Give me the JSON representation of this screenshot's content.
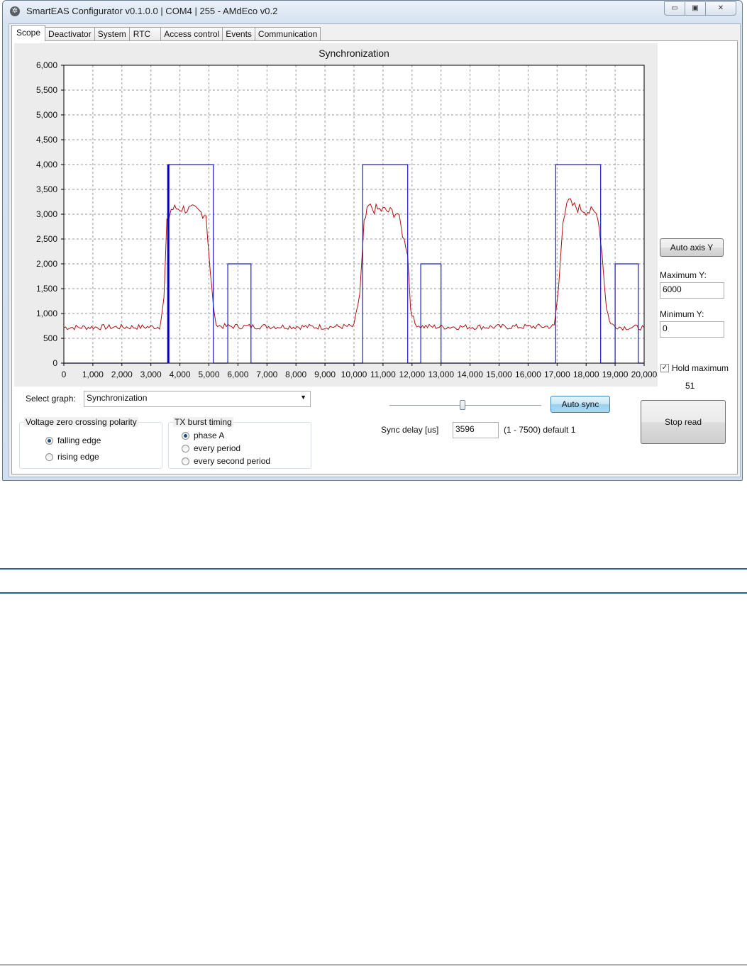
{
  "window": {
    "title": "SmartEAS Configurator v0.1.0.0 | COM4 | 255 - AMdEco v0.2",
    "buttons": [
      "▭",
      "▣",
      "✕"
    ]
  },
  "tabs": [
    "Scope",
    "Deactivator",
    "System",
    "RTC",
    "Access control",
    "Events",
    "Communication"
  ],
  "chart_data": {
    "type": "line",
    "title": "Synchronization",
    "xlim": [
      0,
      20000
    ],
    "ylim": [
      0,
      6000
    ],
    "xticks": [
      0,
      1000,
      2000,
      3000,
      4000,
      5000,
      6000,
      7000,
      8000,
      9000,
      10000,
      11000,
      12000,
      13000,
      14000,
      15000,
      16000,
      17000,
      18000,
      19000,
      20000
    ],
    "yticks": [
      0,
      500,
      1000,
      1500,
      2000,
      2500,
      3000,
      3500,
      4000,
      4500,
      5000,
      5500,
      6000
    ],
    "xtick_labels": [
      "0",
      "1,000",
      "2,000",
      "3,000",
      "4,000",
      "5,000",
      "6,000",
      "7,000",
      "8,000",
      "9,000",
      "10,000",
      "11,000",
      "12,000",
      "13,000",
      "14,000",
      "15,000",
      "16,000",
      "17,000",
      "18,000",
      "19,000",
      "20,000"
    ],
    "ytick_labels": [
      "0",
      "500",
      "1,000",
      "1,500",
      "2,000",
      "2,500",
      "3,000",
      "3,500",
      "4,000",
      "4,500",
      "5,000",
      "5,500",
      "6,000"
    ],
    "grid": true,
    "series": [
      {
        "color": "#b01010",
        "style": "noisy",
        "x": [
          0,
          3300,
          3450,
          3550,
          3700,
          4000,
          4500,
          4900,
          5050,
          5200,
          5300,
          5600,
          7000,
          9000,
          10000,
          10200,
          10350,
          10500,
          10700,
          11000,
          11500,
          11850,
          11950,
          12100,
          12300,
          13000,
          15000,
          16900,
          17050,
          17200,
          17400,
          17600,
          18000,
          18400,
          18550,
          18700,
          18850,
          19200,
          20000
        ],
        "y": [
          720,
          730,
          1300,
          2800,
          3100,
          3120,
          3080,
          3000,
          1800,
          900,
          750,
          740,
          740,
          730,
          740,
          1400,
          2800,
          3150,
          3100,
          3080,
          3020,
          2200,
          1100,
          800,
          740,
          730,
          730,
          740,
          1500,
          2900,
          3250,
          3150,
          3080,
          3000,
          2200,
          1100,
          780,
          720,
          720
        ]
      },
      {
        "color": "#1c1ccc",
        "style": "step",
        "x": [
          0,
          3600,
          3600,
          5150,
          5150,
          5650,
          5650,
          6450,
          6450,
          10300,
          10300,
          11850,
          11850,
          12300,
          12300,
          13000,
          13000,
          16950,
          16950,
          18500,
          18500,
          19000,
          19000,
          19800,
          19800,
          20000
        ],
        "y": [
          0,
          0,
          4000,
          4000,
          0,
          0,
          2000,
          2000,
          0,
          0,
          4000,
          4000,
          0,
          0,
          2000,
          2000,
          0,
          0,
          4000,
          4000,
          0,
          0,
          2000,
          2000,
          0,
          0
        ]
      }
    ],
    "marker": {
      "x": 3600,
      "y_from": 0,
      "y_to": 4000,
      "color": "#0000b0"
    }
  },
  "side": {
    "auto_axis_label": "Auto axis Y",
    "max_label": "Maximum Y:",
    "max_value": "6000",
    "min_label": "Minimum Y:",
    "min_value": "0",
    "hold_label": "Hold maximum",
    "hold_checked": "✓",
    "hold_value": "51",
    "stop_label": "Stop read"
  },
  "controls": {
    "select_label": "Select graph:",
    "select_value": "Synchronization",
    "select_arrow": "▼",
    "auto_sync_label": "Auto sync",
    "sync_delay_label": "Sync delay [us]",
    "sync_delay_value": "3596",
    "sync_delay_hint": "(1 - 7500) default 1",
    "slider_value": 3596,
    "slider_max": 7500
  },
  "polarity": {
    "title": "Voltage zero crossing polarity",
    "options": [
      "falling edge",
      "rising edge"
    ],
    "selected": 0
  },
  "tx": {
    "title": "TX burst timing",
    "options": [
      "phase A",
      "every period",
      "every second period"
    ],
    "selected": 0
  }
}
